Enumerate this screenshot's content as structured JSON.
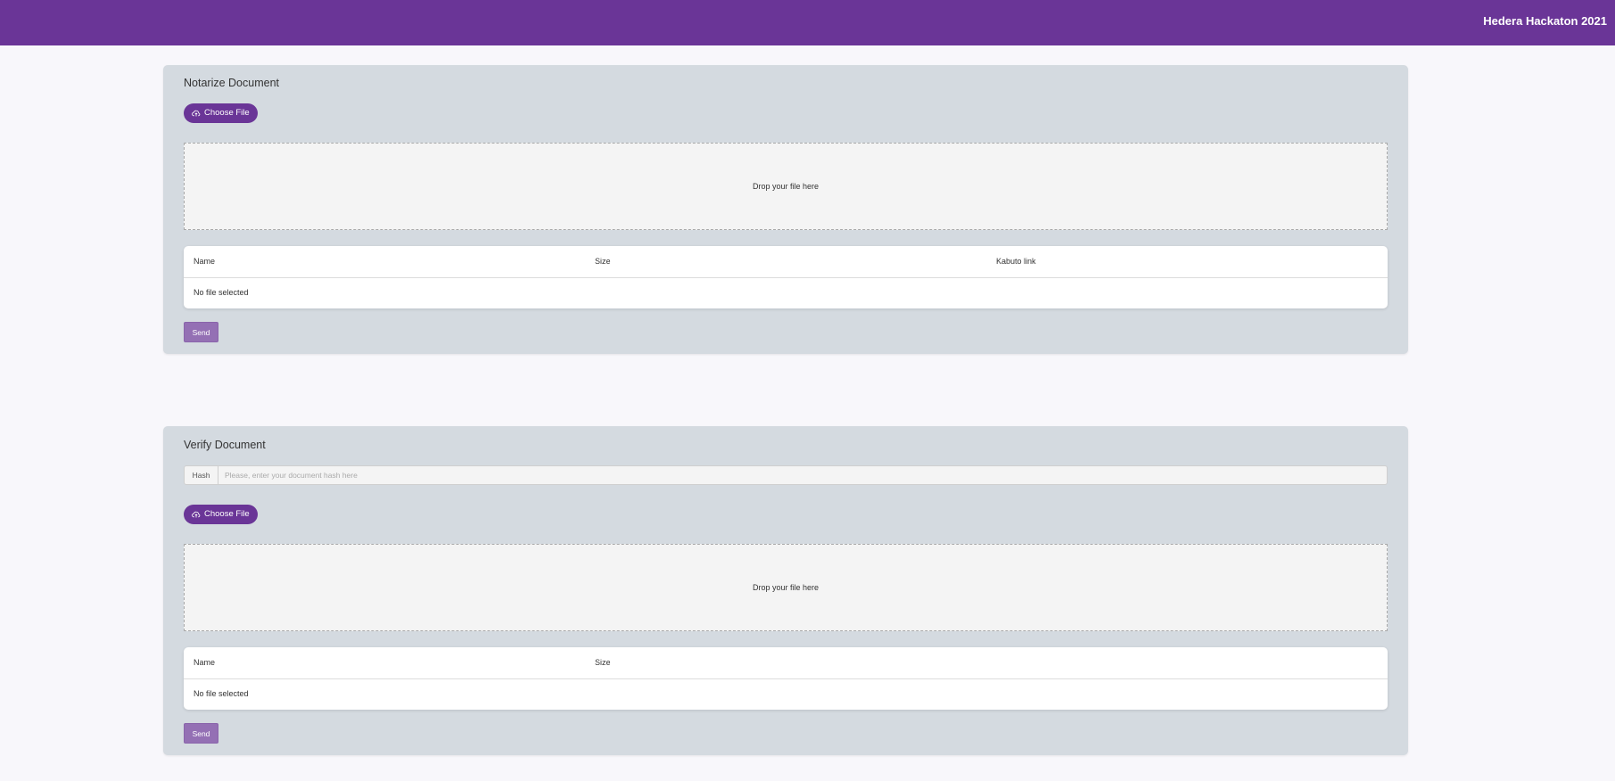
{
  "header": {
    "title": "Hedera Hackaton 2021"
  },
  "notarize": {
    "title": "Notarize Document",
    "choose_label": "Choose File",
    "dropzone_text": "Drop your file here",
    "columns": [
      "Name",
      "Size",
      "Kabuto link"
    ],
    "empty_text": "No file selected",
    "send_label": "Send"
  },
  "verify": {
    "title": "Verify Document",
    "hash_label": "Hash",
    "hash_placeholder": "Please, enter your document hash here",
    "hash_value": "",
    "choose_label": "Choose File",
    "dropzone_text": "Drop your file here",
    "columns": [
      "Name",
      "Size"
    ],
    "empty_text": "No file selected",
    "send_label": "Send"
  },
  "icons": {
    "upload": "cloud-upload-icon"
  },
  "colors": {
    "brand": "#6a3597",
    "send_button": "#9470b4",
    "card_background": "#d4dae0",
    "page_background": "#f8f7fb"
  }
}
